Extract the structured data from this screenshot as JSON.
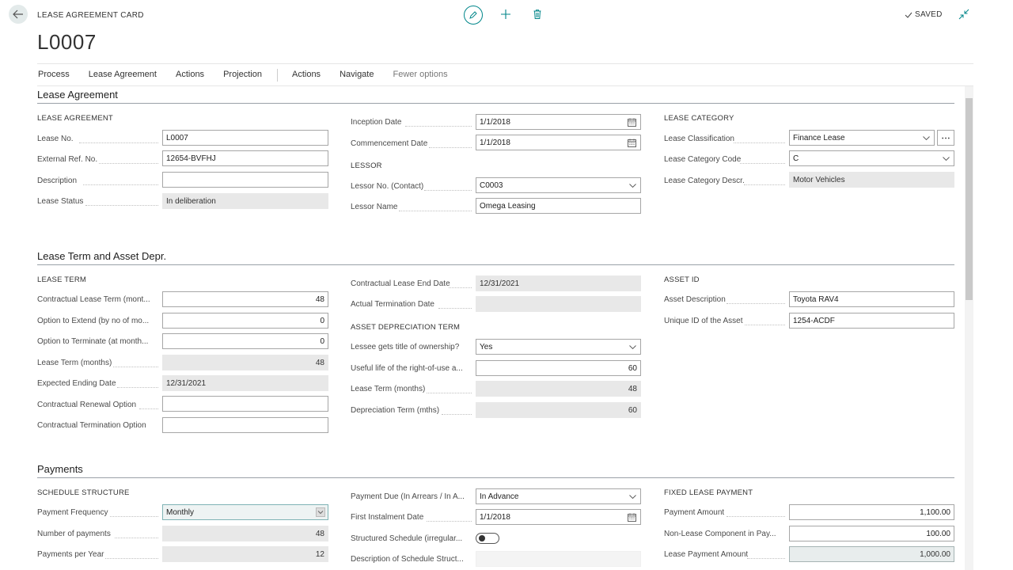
{
  "header": {
    "caption": "LEASE AGREEMENT CARD",
    "record_no": "L0007",
    "status": "SAVED"
  },
  "action_bar": {
    "items": [
      "Process",
      "Lease Agreement",
      "Actions",
      "Projection",
      "Actions",
      "Navigate",
      "Fewer options"
    ]
  },
  "sections": {
    "lease_agreement": {
      "title": "Lease Agreement",
      "left": {
        "group": "LEASE AGREEMENT",
        "lease_no_label": "Lease No.",
        "lease_no": "L0007",
        "ext_ref_label": "External Ref. No.",
        "ext_ref": "12654-BVFHJ",
        "description_label": "Description",
        "description": "",
        "status_label": "Lease Status",
        "status": "In deliberation"
      },
      "middle": {
        "inception_label": "Inception Date",
        "inception": "1/1/2018",
        "commencement_label": "Commencement Date",
        "commencement": "1/1/2018",
        "lessor_group": "LESSOR",
        "lessor_no_label": "Lessor No. (Contact)",
        "lessor_no": "C0003",
        "lessor_name_label": "Lessor Name",
        "lessor_name": "Omega Leasing"
      },
      "right": {
        "group": "LEASE CATEGORY",
        "classification_label": "Lease Classification",
        "classification": "Finance Lease",
        "category_code_label": "Lease Category Code",
        "category_code": "C",
        "category_descr_label": "Lease Category Descr.",
        "category_descr": "Motor Vehicles"
      }
    },
    "lease_term": {
      "title": "Lease Term and Asset Depr.",
      "left": {
        "group": "LEASE TERM",
        "contract_term_label": "Contractual Lease Term (mont...",
        "contract_term": "48",
        "opt_extend_label": "Option to Extend (by no of mo...",
        "opt_extend": "0",
        "opt_terminate_label": "Option to Terminate (at month...",
        "opt_terminate": "0",
        "lease_term_label": "Lease Term (months)",
        "lease_term": "48",
        "exp_end_label": "Expected Ending Date",
        "exp_end": "12/31/2021",
        "renewal_label": "Contractual Renewal Option",
        "renewal": "",
        "termination_label": "Contractual Termination Option",
        "termination": ""
      },
      "middle": {
        "contract_end_label": "Contractual Lease End Date",
        "contract_end": "12/31/2021",
        "actual_term_label": "Actual Termination Date",
        "actual_term": "",
        "depr_group": "ASSET DEPRECIATION TERM",
        "title_own_label": "Lessee gets title of ownership?",
        "title_own": "Yes",
        "useful_life_label": "Useful life of the right-of-use a...",
        "useful_life": "60",
        "lease_term_label": "Lease Term (months)",
        "lease_term": "48",
        "depr_term_label": "Depreciation Term (mths)",
        "depr_term": "60"
      },
      "right": {
        "group": "ASSET ID",
        "asset_descr_label": "Asset Description",
        "asset_descr": "Toyota RAV4",
        "unique_id_label": "Unique ID of the Asset",
        "unique_id": "1254-ACDF"
      }
    },
    "payments": {
      "title": "Payments",
      "left": {
        "group": "SCHEDULE STRUCTURE",
        "frequency_label": "Payment Frequency",
        "frequency": "Monthly",
        "num_payments_label": "Number of payments",
        "num_payments": "48",
        "per_year_label": "Payments per Year",
        "per_year": "12"
      },
      "middle": {
        "due_label": "Payment Due (In Arrears / In A...",
        "due": "In Advance",
        "first_inst_label": "First Instalment Date",
        "first_inst": "1/1/2018",
        "structured_label": "Structured Schedule (irregular...",
        "struct_descr_label": "Description of Schedule Struct...",
        "struct_descr": ""
      },
      "right": {
        "group": "FIXED LEASE PAYMENT",
        "amount_label": "Payment Amount",
        "amount": "1,100.00",
        "non_lease_label": "Non-Lease Component in Pay...",
        "non_lease": "100.00",
        "lease_payment_label": "Lease Payment Amount",
        "lease_payment": "1,000.00"
      }
    }
  }
}
